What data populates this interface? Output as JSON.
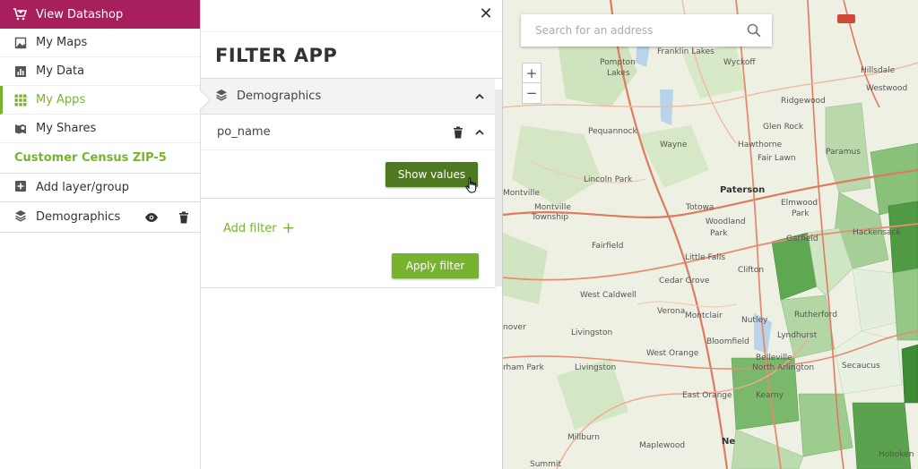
{
  "sidebar": {
    "datashop_label": "View Datashop",
    "nav": [
      {
        "label": "My Maps",
        "icon": "image-icon"
      },
      {
        "label": "My Data",
        "icon": "bar-chart-icon"
      },
      {
        "label": "My Apps",
        "icon": "apps-grid-icon",
        "active": true
      },
      {
        "label": "My Shares",
        "icon": "share-map-icon"
      }
    ],
    "map_title": "Customer Census ZIP-5",
    "add_layer_label": "Add layer/group",
    "layer": {
      "label": "Demographics"
    }
  },
  "panel": {
    "title": "FILTER APP",
    "section_label": "Demographics",
    "field_name": "po_name",
    "show_values_label": "Show values",
    "add_filter_label": "Add filter",
    "add_filter_plus": "+",
    "apply_label": "Apply filter",
    "close_glyph": "✕"
  },
  "map": {
    "search_placeholder": "Search for an address",
    "zoom_in": "+",
    "zoom_out": "−",
    "labels": [
      {
        "text": "Franklin Lakes"
      },
      {
        "text": "Pompton"
      },
      {
        "text": "Lakes"
      },
      {
        "text": "Wyckoff"
      },
      {
        "text": "Hillsdale"
      },
      {
        "text": "Westwood"
      },
      {
        "text": "Ridgewood"
      },
      {
        "text": "Glen Rock"
      },
      {
        "text": "Pequannock"
      },
      {
        "text": "Hawthorne"
      },
      {
        "text": "Wayne"
      },
      {
        "text": "Fair Lawn"
      },
      {
        "text": "Paramus"
      },
      {
        "text": "Lincoln Park"
      },
      {
        "text": "Paterson"
      },
      {
        "text": "Elmwood"
      },
      {
        "text": "Park"
      },
      {
        "text": "Montville"
      },
      {
        "text": "Montville"
      },
      {
        "text": "Township"
      },
      {
        "text": "Totowa"
      },
      {
        "text": "Woodland"
      },
      {
        "text": "Park"
      },
      {
        "text": "Garfield"
      },
      {
        "text": "Hackensack"
      },
      {
        "text": "Fairfield"
      },
      {
        "text": "Little Falls"
      },
      {
        "text": "Clifton"
      },
      {
        "text": "Cedar Grove"
      },
      {
        "text": "West Caldwell"
      },
      {
        "text": "Rutherford"
      },
      {
        "text": "Verona"
      },
      {
        "text": "Montclair"
      },
      {
        "text": "Nutley"
      },
      {
        "text": "Lyndhurst"
      },
      {
        "text": "nover"
      },
      {
        "text": "Livingston"
      },
      {
        "text": "Bloomfield"
      },
      {
        "text": "West Orange"
      },
      {
        "text": "Belleville"
      },
      {
        "text": "North Arlington"
      },
      {
        "text": "Secaucus"
      },
      {
        "text": "rham Park"
      },
      {
        "text": "Livingston"
      },
      {
        "text": "East Orange"
      },
      {
        "text": "Kearny"
      },
      {
        "text": "Millburn"
      },
      {
        "text": "Maplewood"
      },
      {
        "text": "Summit"
      },
      {
        "text": "Hoboken"
      },
      {
        "text": "Ne"
      }
    ]
  }
}
